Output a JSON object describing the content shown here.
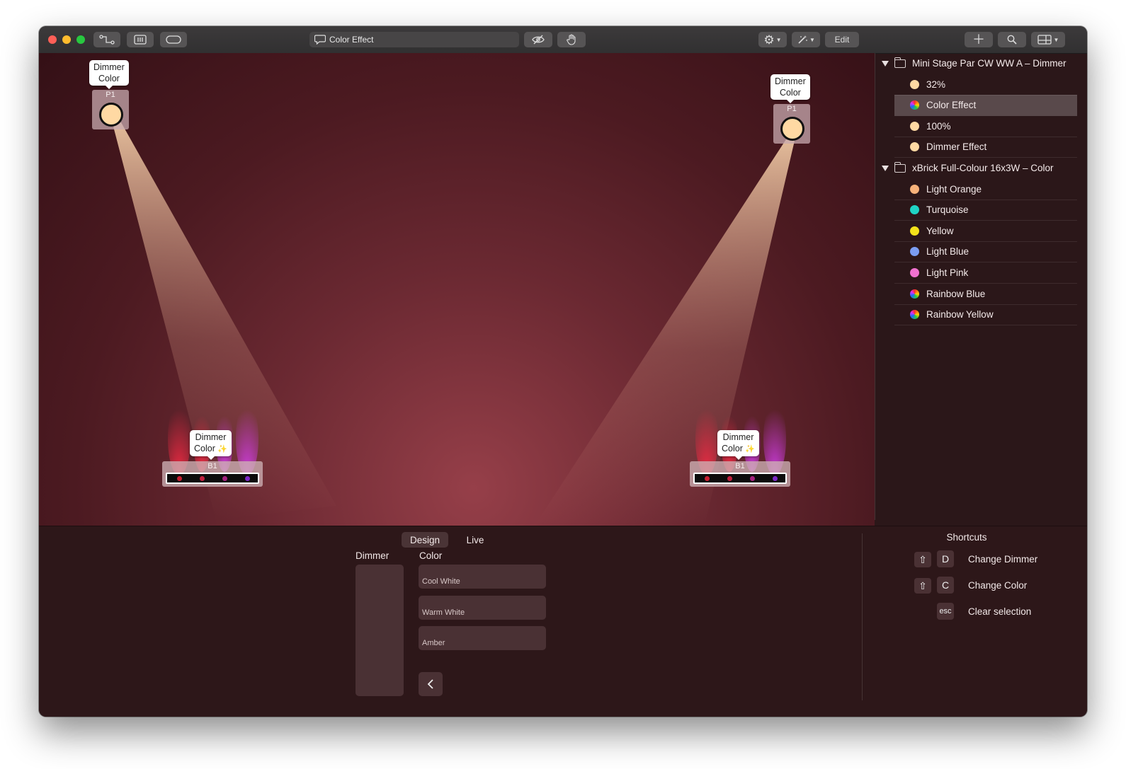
{
  "toolbar": {
    "document_title": "Color Effect",
    "edit_label": "Edit"
  },
  "stage": {
    "fixtures": [
      {
        "tag_line1": "Dimmer",
        "tag_line2": "Color",
        "label": "P1",
        "bulb_color": "#ffd9a3"
      },
      {
        "tag_line1": "Dimmer",
        "tag_line2": "Color",
        "label": "P1",
        "bulb_color": "#ffd9a3"
      },
      {
        "tag_line1": "Dimmer",
        "tag_line2": "Color",
        "label": "B1"
      },
      {
        "tag_line1": "Dimmer",
        "tag_line2": "Color",
        "label": "B1"
      }
    ]
  },
  "sidebar": {
    "groups": [
      {
        "name": "Mini Stage Par CW WW A – Dimmer",
        "items": [
          {
            "label": "32%",
            "color": "#ffd9a3"
          },
          {
            "label": "Color Effect",
            "color": "rainbow",
            "selected": true
          },
          {
            "label": "100%",
            "color": "#ffd9a3"
          },
          {
            "label": "Dimmer Effect",
            "color": "#ffd9a3"
          }
        ]
      },
      {
        "name": "xBrick Full-Colour 16x3W – Color",
        "items": [
          {
            "label": "Light Orange",
            "color": "#f7b27a"
          },
          {
            "label": "Turquoise",
            "color": "#1fd3c4"
          },
          {
            "label": "Yellow",
            "color": "#f4e21a"
          },
          {
            "label": "Light Blue",
            "color": "#7b9df2"
          },
          {
            "label": "Light Pink",
            "color": "#f071cf"
          },
          {
            "label": "Rainbow Blue",
            "color": "rainbow"
          },
          {
            "label": "Rainbow Yellow",
            "color": "rainbow"
          }
        ]
      }
    ]
  },
  "bottom": {
    "tabs": [
      "Design",
      "Live"
    ],
    "active_tab": "Design",
    "dimmer_header": "Dimmer",
    "color_header": "Color",
    "color_options": [
      "Cool White",
      "Warm White",
      "Amber"
    ],
    "shortcuts_title": "Shortcuts",
    "shortcuts": [
      {
        "modifier": "⇧",
        "key": "D",
        "label": "Change Dimmer"
      },
      {
        "modifier": "⇧",
        "key": "C",
        "label": "Change Color"
      },
      {
        "modifier": "",
        "key": "esc",
        "label": "Clear selection"
      }
    ]
  }
}
